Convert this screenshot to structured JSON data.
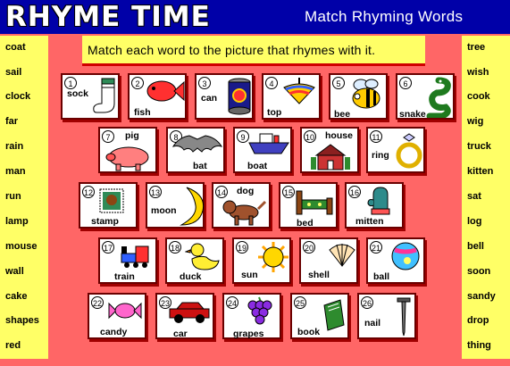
{
  "title": "RHYME TIME",
  "subtitle": "Match Rhyming Words",
  "instructions": "Match each word to the picture that rhymes with it.",
  "left_words": [
    "coat",
    "sail",
    "clock",
    "far",
    "rain",
    "man",
    "run",
    "lamp",
    "mouse",
    "wall",
    "cake",
    "shapes",
    "red"
  ],
  "right_words": [
    "tree",
    "wish",
    "cook",
    "wig",
    "truck",
    "kitten",
    "sat",
    "log",
    "bell",
    "soon",
    "sandy",
    "drop",
    "thing"
  ],
  "cards": [
    {
      "num": "1",
      "label": "sock",
      "icon": "sock-icon"
    },
    {
      "num": "2",
      "label": "fish",
      "icon": "fish-icon"
    },
    {
      "num": "3",
      "label": "can",
      "icon": "can-icon"
    },
    {
      "num": "4",
      "label": "top",
      "icon": "spinning-top-icon"
    },
    {
      "num": "5",
      "label": "bee",
      "icon": "bee-icon"
    },
    {
      "num": "6",
      "label": "snake",
      "icon": "snake-icon"
    },
    {
      "num": "7",
      "label": "pig",
      "icon": "pig-icon"
    },
    {
      "num": "8",
      "label": "bat",
      "icon": "bat-icon"
    },
    {
      "num": "9",
      "label": "boat",
      "icon": "boat-icon"
    },
    {
      "num": "10",
      "label": "house",
      "icon": "house-icon"
    },
    {
      "num": "11",
      "label": "ring",
      "icon": "ring-icon"
    },
    {
      "num": "12",
      "label": "stamp",
      "icon": "stamp-icon"
    },
    {
      "num": "13",
      "label": "moon",
      "icon": "moon-icon"
    },
    {
      "num": "14",
      "label": "dog",
      "icon": "dog-icon"
    },
    {
      "num": "15",
      "label": "bed",
      "icon": "bed-icon"
    },
    {
      "num": "16",
      "label": "mitten",
      "icon": "mitten-icon"
    },
    {
      "num": "17",
      "label": "train",
      "icon": "train-icon"
    },
    {
      "num": "18",
      "label": "duck",
      "icon": "duck-icon"
    },
    {
      "num": "19",
      "label": "sun",
      "icon": "sun-icon"
    },
    {
      "num": "20",
      "label": "shell",
      "icon": "shell-icon"
    },
    {
      "num": "21",
      "label": "ball",
      "icon": "ball-icon"
    },
    {
      "num": "22",
      "label": "candy",
      "icon": "candy-icon"
    },
    {
      "num": "23",
      "label": "car",
      "icon": "car-icon"
    },
    {
      "num": "24",
      "label": "grapes",
      "icon": "grapes-icon"
    },
    {
      "num": "25",
      "label": "book",
      "icon": "book-icon"
    },
    {
      "num": "26",
      "label": "nail",
      "icon": "nail-icon"
    }
  ],
  "colors": {
    "background": "#ff6666",
    "title_bar": "#0000a8",
    "panel": "#ffff66",
    "card_border": "#6a0000"
  }
}
